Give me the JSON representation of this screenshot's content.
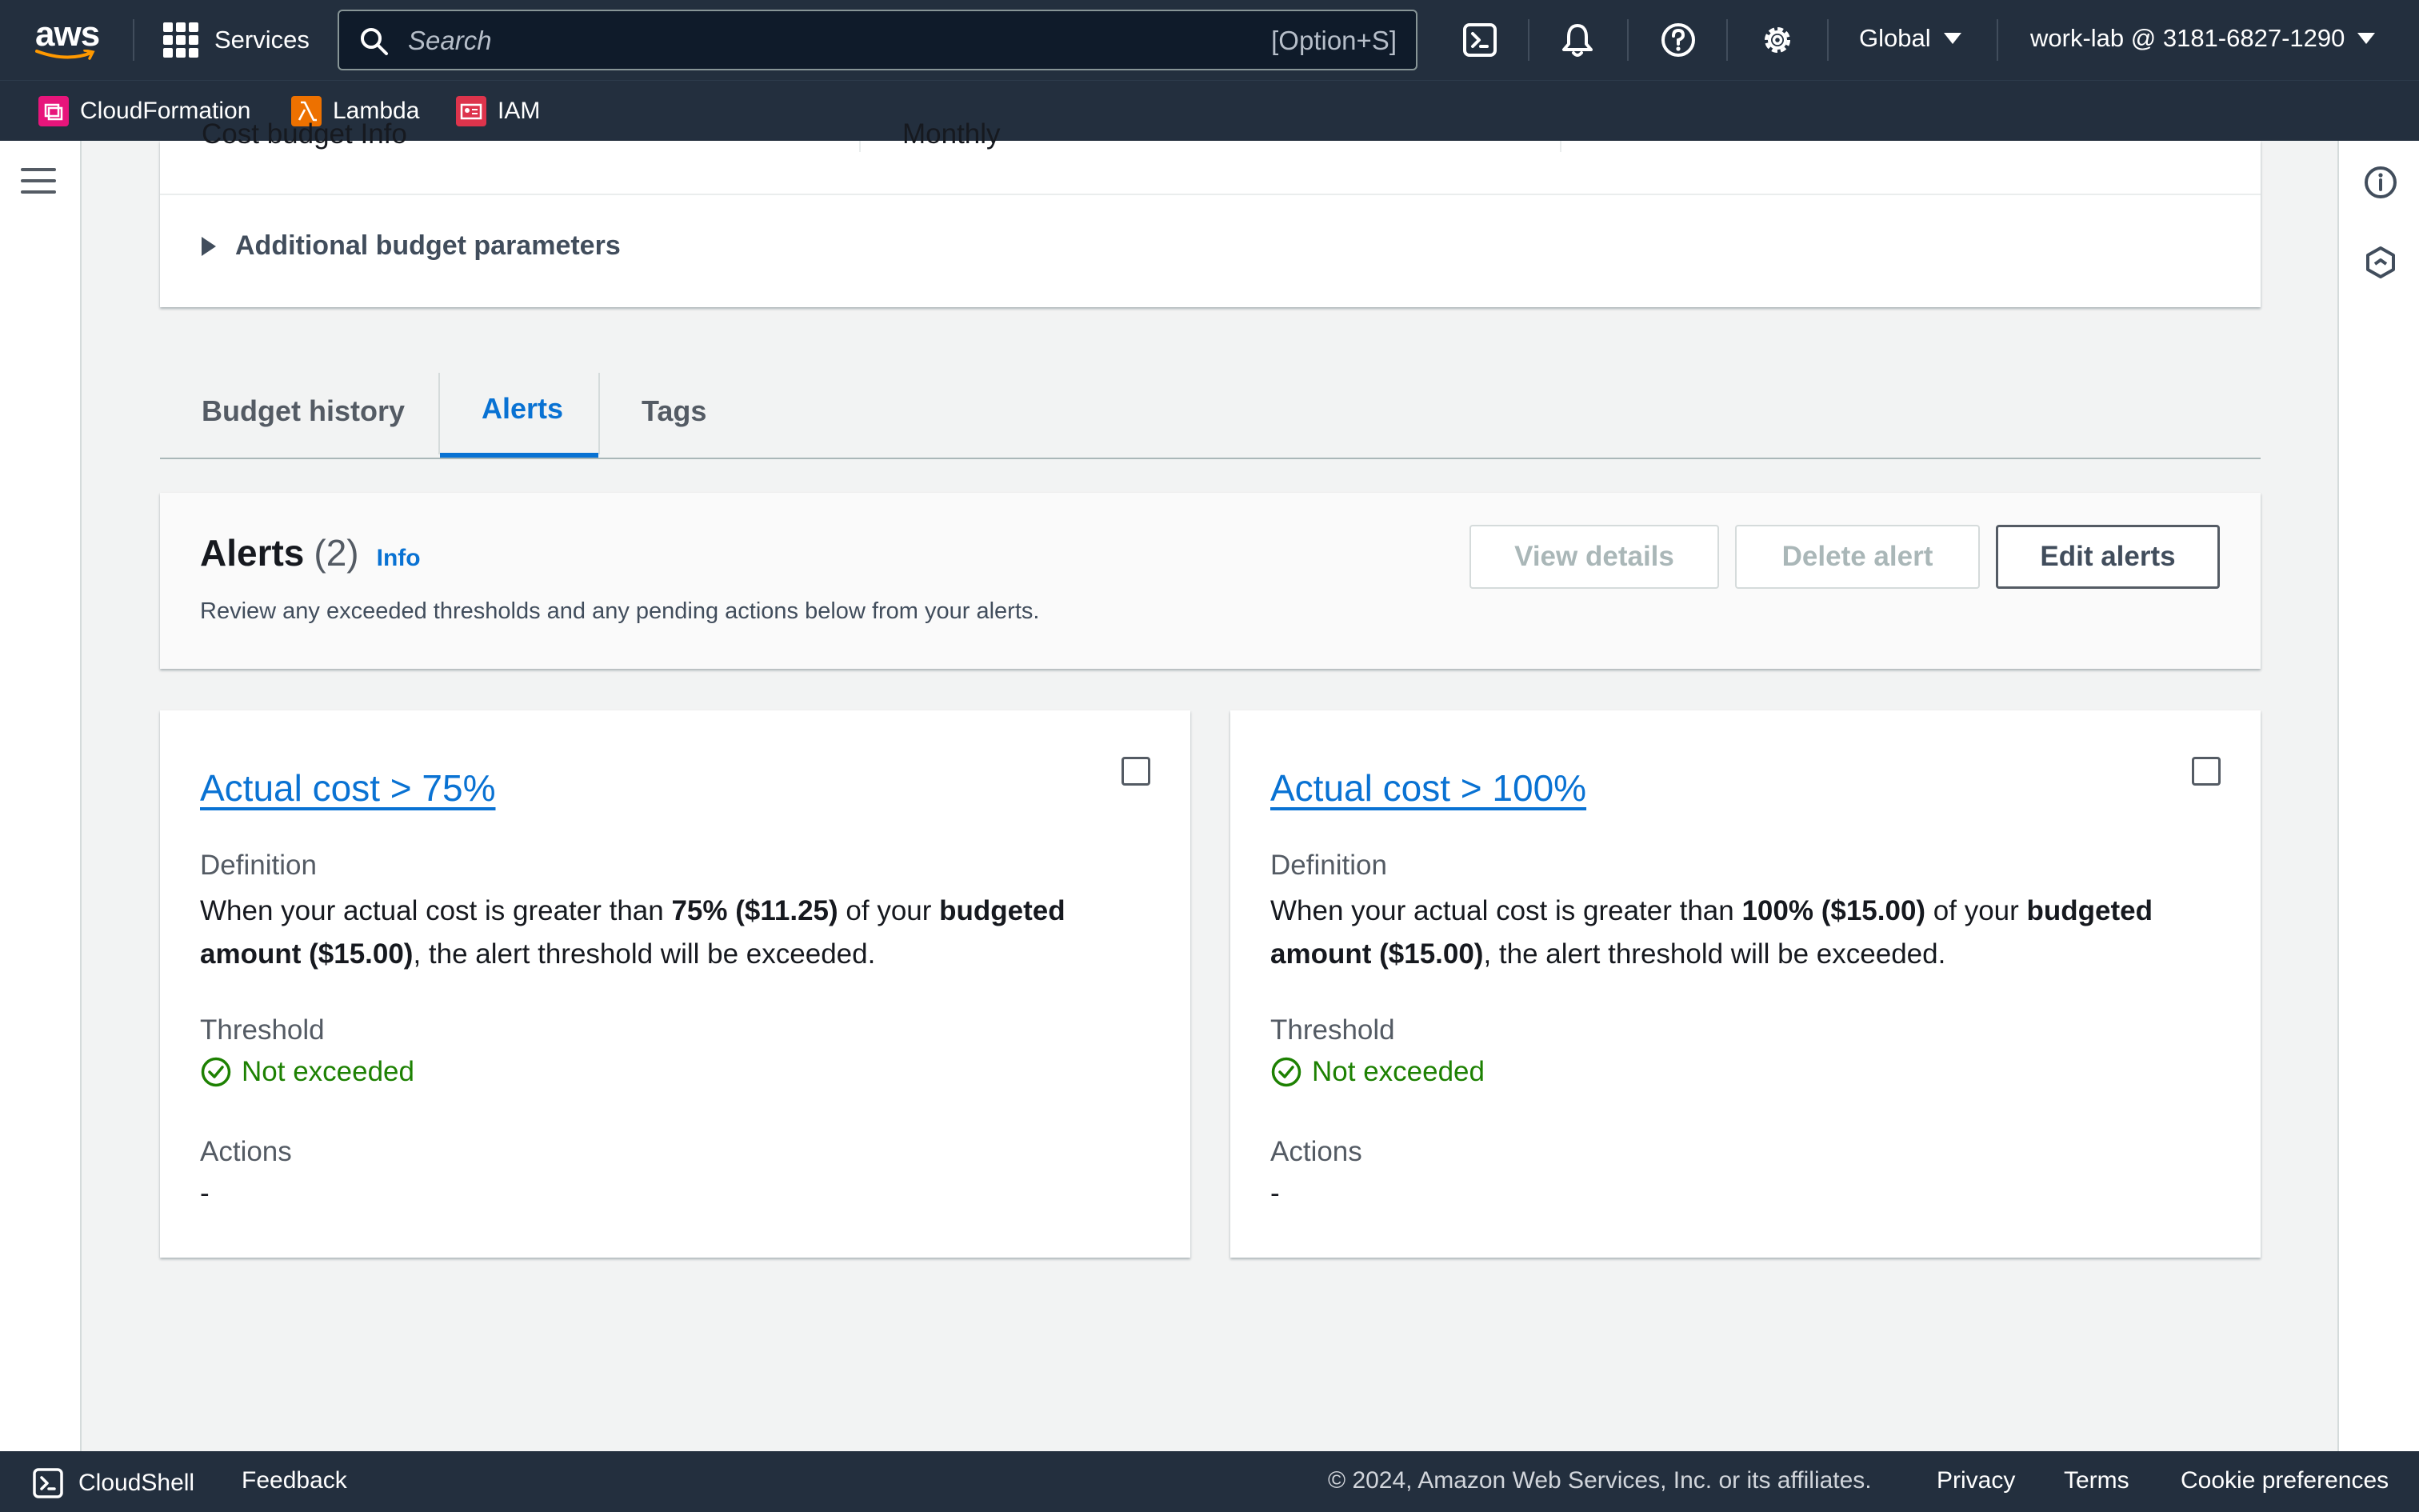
{
  "topnav": {
    "logo": "aws",
    "services_label": "Services",
    "search_placeholder": "Search",
    "search_shortcut": "[Option+S]",
    "region": "Global",
    "account": "work-lab @ 3181-6827-1290",
    "icons": [
      "cloudshell-icon",
      "bell-icon",
      "help-icon",
      "settings-icon"
    ]
  },
  "favorites": [
    {
      "label": "CloudFormation",
      "color": "#e7157b"
    },
    {
      "label": "Lambda",
      "color": "#ed7100"
    },
    {
      "label": "IAM",
      "color": "#dd344c"
    }
  ],
  "top_card": {
    "cut_left": "Cost budget Info",
    "cut_right": "Monthly",
    "expander": "Additional budget parameters"
  },
  "tabs": [
    {
      "label": "Budget history",
      "active": false
    },
    {
      "label": "Alerts",
      "active": true
    },
    {
      "label": "Tags",
      "active": false
    }
  ],
  "alerts_header": {
    "title": "Alerts",
    "count": "(2)",
    "info": "Info",
    "description": "Review any exceeded thresholds and any pending actions below from your alerts.",
    "buttons": {
      "view_details": "View details",
      "delete_alert": "Delete alert",
      "edit_alerts": "Edit alerts"
    }
  },
  "alerts": [
    {
      "title": "Actual cost > 75%",
      "definition_label": "Definition",
      "def_pre": "When your actual cost is greater than ",
      "def_threshold": "75% ($11.25)",
      "def_mid": " of your ",
      "def_budget": "budgeted amount ($15.00)",
      "def_post": ", the alert threshold will be exceeded.",
      "threshold_label": "Threshold",
      "threshold_status": "Not exceeded",
      "actions_label": "Actions",
      "actions_value": "-"
    },
    {
      "title": "Actual cost > 100%",
      "definition_label": "Definition",
      "def_pre": "When your actual cost is greater than ",
      "def_threshold": "100% ($15.00)",
      "def_mid": " of your ",
      "def_budget": "budgeted amount ($15.00)",
      "def_post": ", the alert threshold will be exceeded.",
      "threshold_label": "Threshold",
      "threshold_status": "Not exceeded",
      "actions_label": "Actions",
      "actions_value": "-"
    }
  ],
  "footer": {
    "cloudshell": "CloudShell",
    "feedback": "Feedback",
    "copyright": "© 2024, Amazon Web Services, Inc. or its affiliates.",
    "privacy": "Privacy",
    "terms": "Terms",
    "cookie": "Cookie preferences"
  },
  "colors": {
    "nav_bg": "#232f3e",
    "link_blue": "#0972d3",
    "success_green": "#1d8102"
  }
}
